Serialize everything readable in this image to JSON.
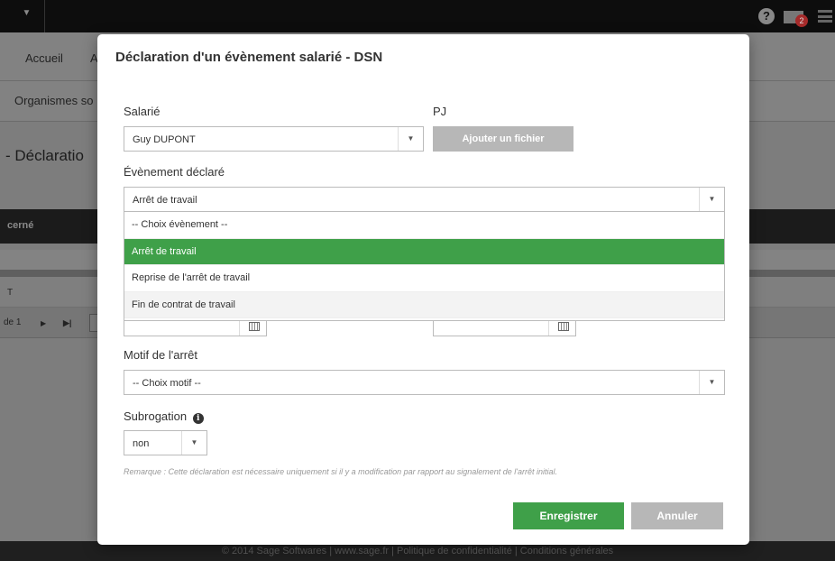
{
  "background": {
    "nav_items": [
      "Accueil",
      "A"
    ],
    "sub_nav": "Organismes so",
    "page_title": "- Déclaratio",
    "table_header": "cerné",
    "row_text": "T",
    "pager_text": "de 1",
    "pager_icons": [
      "play-icon",
      "skip-end-icon"
    ],
    "help_icon": "?",
    "mail_badge": "2",
    "footer": "© 2014 Sage Softwares | www.sage.fr | Politique de confidentialité | Conditions générales"
  },
  "modal": {
    "title": "Déclaration d'un évènement salarié - DSN",
    "salarie": {
      "label": "Salarié",
      "value": "Guy DUPONT"
    },
    "pj": {
      "label": "PJ",
      "button": "Ajouter un fichier"
    },
    "evenement": {
      "label": "Évènement déclaré",
      "value": "Arrêt de travail",
      "options": [
        "-- Choix évènement --",
        "Arrêt de travail",
        "Reprise de l'arrêt de travail",
        "Fin de contrat de travail"
      ],
      "selected_index": 1,
      "hovered_index": 3
    },
    "motif": {
      "label": "Motif de l'arrêt",
      "value": "-- Choix motif --"
    },
    "subrogation": {
      "label": "Subrogation",
      "value": "non"
    },
    "remark": "Remarque : Cette déclaration est nécessaire uniquement si il y a modification par rapport au signalement de l'arrêt initial.",
    "save_button": "Enregistrer",
    "cancel_button": "Annuler"
  },
  "colors": {
    "accent": "#3fa049",
    "secondary_button": "#b7b7b7",
    "overlay": "#7d7d7d"
  }
}
